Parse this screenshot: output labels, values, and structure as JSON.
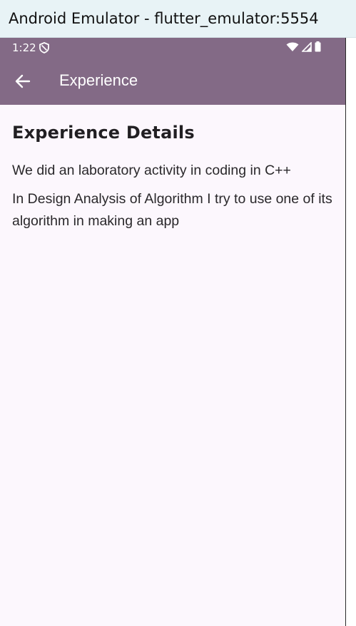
{
  "window": {
    "title": "Android Emulator - flutter_emulator:5554"
  },
  "status_bar": {
    "time": "1:22",
    "icons": [
      "shield-icon",
      "wifi-icon",
      "cell-signal-icon",
      "battery-icon"
    ]
  },
  "app_bar": {
    "title": "Experience",
    "back_icon": "arrow-left-icon"
  },
  "main": {
    "heading": "Experience Details",
    "paragraphs": [
      "We did an laboratory activity in coding in C++",
      "In Design Analysis of Algorithm I try to use one of its algorithm in making an app"
    ]
  },
  "colors": {
    "app_bar": "#836a86",
    "background": "#fcf7fd",
    "titlebar": "#e8f3f6"
  }
}
